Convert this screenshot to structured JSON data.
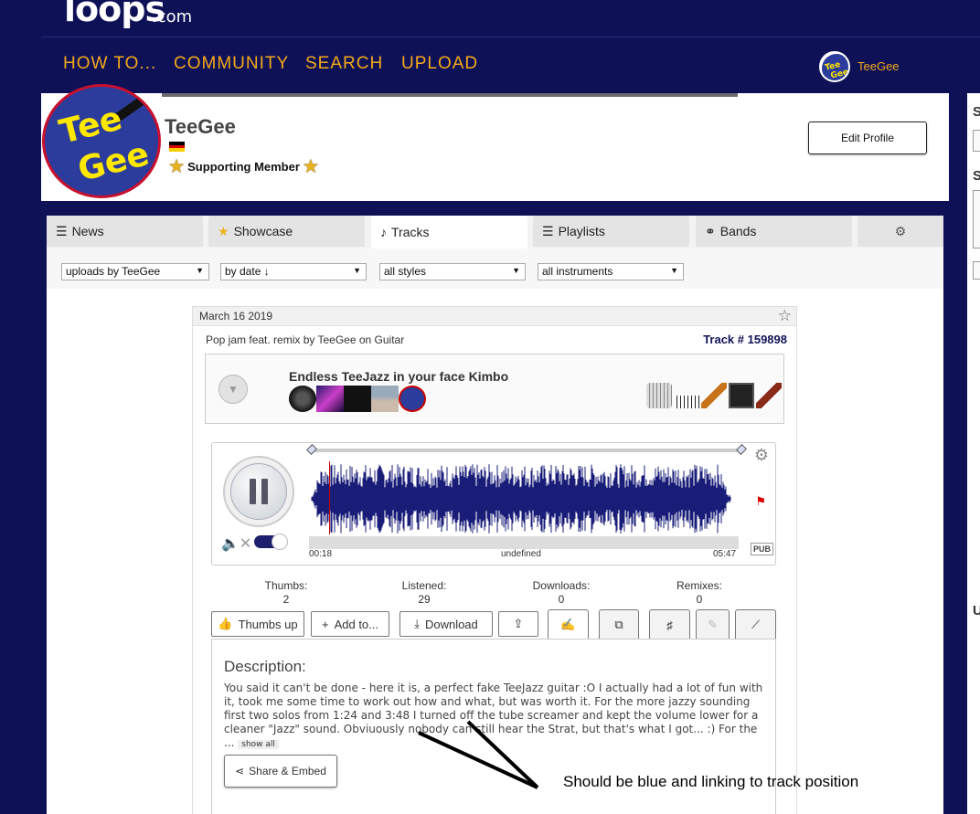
{
  "site": {
    "logo_text": "loops",
    "logo_suffix": ".com"
  },
  "nav": {
    "items": [
      "HOW TO...",
      "COMMUNITY",
      "SEARCH",
      "UPLOAD"
    ],
    "username": "TeeGee",
    "accent_color": "#f4a91a",
    "background_color": "#0f1157"
  },
  "profile": {
    "name": "TeeGee",
    "avatar_text": [
      "Tee",
      "Gee"
    ],
    "badge": "Supporting Member",
    "edit_button": "Edit Profile",
    "flag": "germany"
  },
  "tabs": [
    {
      "label": "News",
      "icon": "menu-icon"
    },
    {
      "label": "Showcase",
      "icon": "star-icon"
    },
    {
      "label": "Tracks",
      "icon": "music-note-icon",
      "active": true
    },
    {
      "label": "Playlists",
      "icon": "list-icon"
    },
    {
      "label": "Bands",
      "icon": "band-icon"
    },
    {
      "label": "",
      "icon": "gear-icon"
    }
  ],
  "filters": {
    "uploads": "uploads by TeeGee",
    "sort": "by date ↓",
    "styles": "all styles",
    "instruments": "all instruments"
  },
  "track": {
    "date": "March 16 2019",
    "subtitle": "Pop jam feat. remix by TeeGee on Guitar",
    "track_number": "Track # 159898",
    "title": "Endless TeeJazz in your face Kimbo",
    "contributor_thumb_count": 5,
    "instrument_icons": [
      "drum-icon",
      "keyboard-icon",
      "guitar-icon",
      "amp-icon",
      "guitar-icon"
    ]
  },
  "player": {
    "state": "playing",
    "current_time": "00:18",
    "middle_label": "undefined",
    "duration": "05:47",
    "pub_label": "PUB",
    "progress_fraction": 0.052
  },
  "stats": [
    {
      "label": "Thumbs:",
      "value": "2"
    },
    {
      "label": "Listened:",
      "value": "29"
    },
    {
      "label": "Downloads:",
      "value": "0"
    },
    {
      "label": "Remixes:",
      "value": "0"
    }
  ],
  "actions": {
    "thumbs_up": "Thumbs up",
    "add_to": "Add to...",
    "download": "Download"
  },
  "description": {
    "heading": "Description:",
    "text": "You said it can't be done - here it is, a perfect fake TeeJazz guitar :O I actually had a lot of fun with it, took me some time to work out how and what, but was worth it. For the more jazzy sounding first two solos from 1:24 and 3:48 I turned off the tube screamer and kept the volume lower for a cleaner \"Jazz\" sound. Obviuously nobody can still hear the Strat, but that's what I got... :) For the ...",
    "show_all": "show all",
    "share_button": "Share & Embed"
  },
  "annotation": {
    "text": "Should be blue and linking to track position"
  }
}
